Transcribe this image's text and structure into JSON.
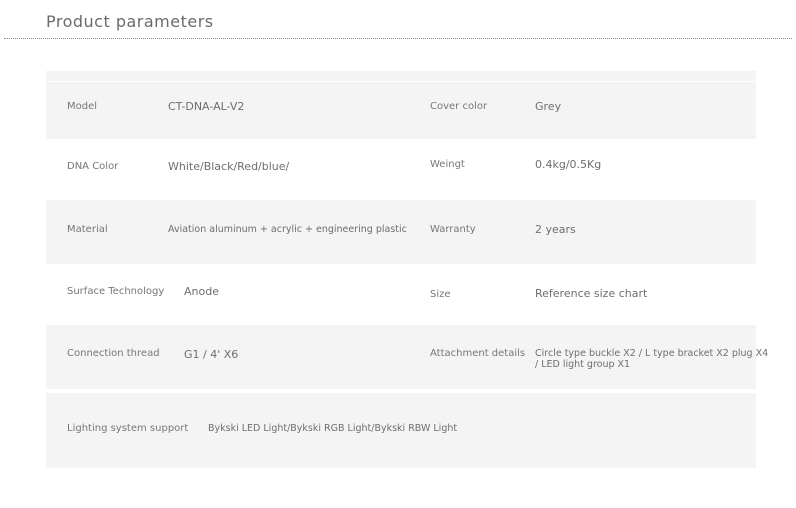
{
  "header": {
    "title": "Product parameters"
  },
  "params": {
    "model_label": "Model",
    "model_value": "CT-DNA-AL-V2",
    "cover_color_label": "Cover color",
    "cover_color_value": "Grey",
    "dna_color_label": "DNA Color",
    "dna_color_value": "White/Black/Red/blue/",
    "weight_label": "Weingt",
    "weight_value": "0.4kg/0.5Kg",
    "material_label": "Material",
    "material_value": "Aviation aluminum + acrylic + engineering plastic",
    "warranty_label": "Warranty",
    "warranty_value": "2 years",
    "surface_label": "Surface Technology",
    "surface_value": "Anode",
    "size_label": "Size",
    "size_value": "Reference size chart",
    "thread_label": "Connection thread",
    "thread_value": "G1 / 4' X6",
    "attachment_label": "Attachment details",
    "attachment_value": "Circle type buckle X2 / L type bracket X2 plug X4 / LED light group X1",
    "lighting_label": "Lighting system support",
    "lighting_value": "Bykski LED Light/Bykski RGB Light/Bykski RBW Light"
  }
}
